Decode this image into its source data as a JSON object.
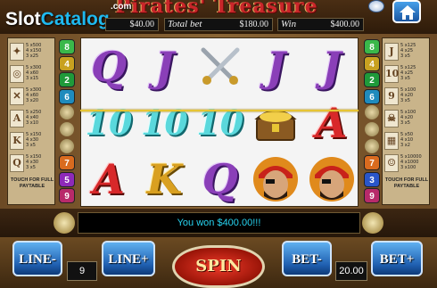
{
  "header": {
    "logo_slot": "Slot",
    "logo_catalog": "Catalog",
    "logo_com": ".com",
    "game_title": "Pirates' Treasure",
    "win_prefix_value": "$40.00",
    "total_bet_label": "Total bet",
    "total_bet_value": "$180.00",
    "win_label": "Win",
    "win_value": "$400.00"
  },
  "left_paytable": {
    "rows": [
      {
        "symbol": "compass",
        "glyph": "✦",
        "pays": [
          "5 x500",
          "4 x150",
          "3 x25"
        ]
      },
      {
        "symbol": "compass",
        "glyph": "◎",
        "pays": [
          "5 x300",
          "4 x60",
          "3 x15"
        ]
      },
      {
        "symbol": "swords",
        "glyph": "✕",
        "pays": [
          "5 x300",
          "4 x60",
          "3 x20"
        ]
      },
      {
        "symbol": "A",
        "glyph": "A",
        "pays": [
          "5 x250",
          "4 x40",
          "3 x10"
        ]
      },
      {
        "symbol": "K",
        "glyph": "K",
        "pays": [
          "5 x150",
          "4 x30",
          "3 x5"
        ]
      },
      {
        "symbol": "Q",
        "glyph": "Q",
        "pays": [
          "5 x150",
          "4 x30",
          "3 x5"
        ]
      }
    ],
    "touch_label": "TOUCH FOR FULL PAYTABLE"
  },
  "right_paytable": {
    "rows": [
      {
        "symbol": "J",
        "glyph": "J",
        "pays": [
          "5 x125",
          "4 x25",
          "3 x5"
        ]
      },
      {
        "symbol": "10",
        "glyph": "10",
        "pays": [
          "5 x125",
          "4 x25",
          "3 x5"
        ]
      },
      {
        "symbol": "9",
        "glyph": "9",
        "pays": [
          "5 x100",
          "4 x20",
          "3 x5"
        ]
      },
      {
        "symbol": "scatter",
        "glyph": "☠",
        "pays": [
          "5 x100",
          "4 x20",
          "3 x5"
        ]
      },
      {
        "symbol": "map",
        "glyph": "▦",
        "pays": [
          "5 x50",
          "4 x10",
          "3 x2"
        ]
      },
      {
        "symbol": "pirate",
        "glyph": "☺",
        "pays": [
          "5 x10000",
          "4 x1000",
          "3 x100"
        ]
      }
    ],
    "touch_label": "TOUCH FOR FULL PAYTABLE"
  },
  "left_lines": [
    "8",
    "4",
    "2",
    "6",
    "",
    "",
    "",
    "7",
    "5",
    "9"
  ],
  "right_lines": [
    "8",
    "4",
    "2",
    "6",
    "",
    "",
    "",
    "7",
    "3",
    "9"
  ],
  "colors": {
    "line_colors": [
      "#d42b20",
      "#1f9a3a",
      "#2a56c8",
      "#c8a120",
      "#8e2ab8",
      "#1f8bbd",
      "#d96b1f",
      "#3ab84a",
      "#b82a6a",
      "#2a8a8a"
    ]
  },
  "reels": [
    [
      "Q",
      "10",
      "A"
    ],
    [
      "J",
      "10",
      "K"
    ],
    [
      "swords",
      "10",
      "Q"
    ],
    [
      "J",
      "chest",
      "pirate"
    ],
    [
      "J",
      "A",
      "pirate"
    ]
  ],
  "message": "You won $400.00!!!",
  "controls": {
    "line_minus": "LINE-",
    "lines_value": "9",
    "line_plus": "LINE+",
    "spin": "SPIN",
    "bet_minus": "BET-",
    "bet_value": "20.00",
    "bet_plus": "BET+"
  }
}
